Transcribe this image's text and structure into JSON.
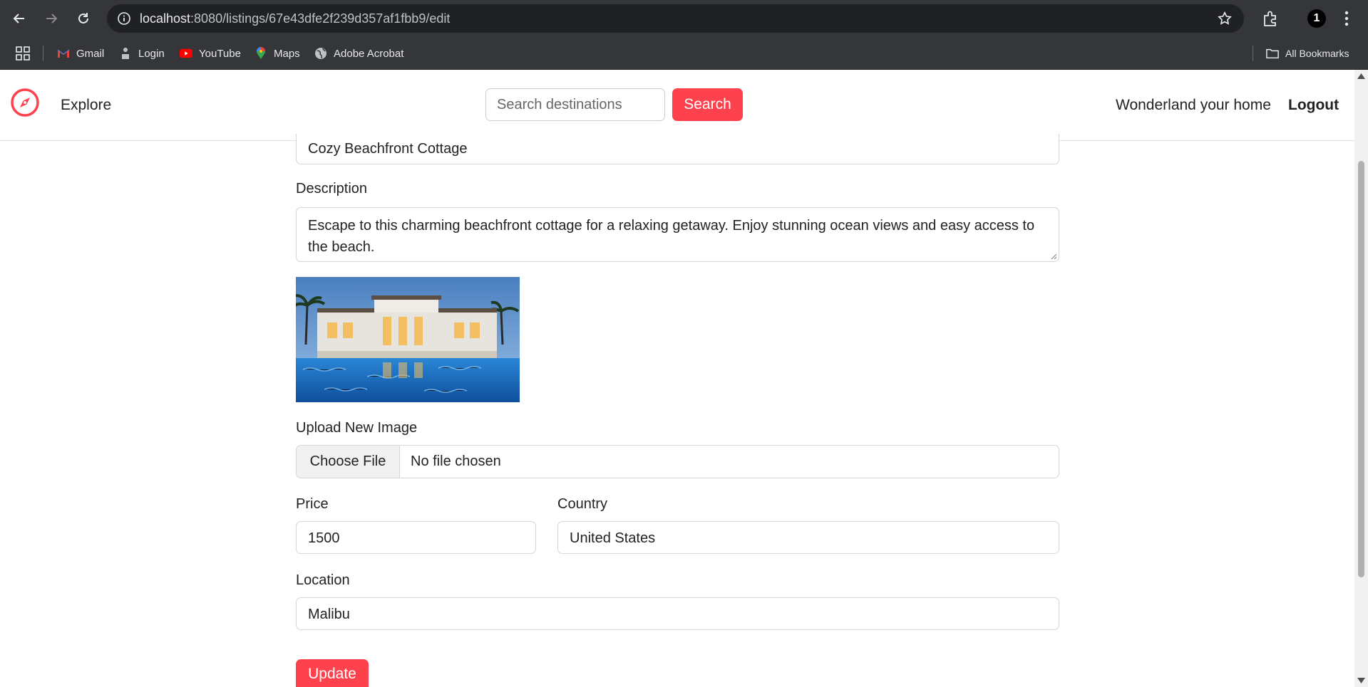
{
  "browser": {
    "url_host": "localhost",
    "url_path": ":8080/listings/67e43dfe2f239d357af1fbb9/edit",
    "profile_initial": "1",
    "bookmarks": [
      {
        "label": "Gmail",
        "icon": "gmail-icon"
      },
      {
        "label": "Login",
        "icon": "login-icon"
      },
      {
        "label": "YouTube",
        "icon": "youtube-icon"
      },
      {
        "label": "Maps",
        "icon": "maps-icon"
      },
      {
        "label": "Adobe Acrobat",
        "icon": "globe-icon"
      }
    ],
    "all_bookmarks": "All Bookmarks"
  },
  "navbar": {
    "brand_icon": "compass-icon",
    "explore": "Explore",
    "search_placeholder": "Search destinations",
    "search_button": "Search",
    "host_link": "Wonderland your home",
    "logout": "Logout"
  },
  "form": {
    "title_value": "Cozy Beachfront Cottage",
    "description_label": "Description",
    "description_value": "Escape to this charming beachfront cottage for a relaxing getaway. Enjoy stunning ocean views and easy access to the beach.",
    "upload_label": "Upload New Image",
    "choose_file": "Choose File",
    "no_file": "No file chosen",
    "price_label": "Price",
    "price_value": "1500",
    "country_label": "Country",
    "country_value": "United States",
    "location_label": "Location",
    "location_value": "Malibu",
    "update_button": "Update"
  },
  "colors": {
    "accent": "#fe424d",
    "chrome_bg": "#35363a",
    "omnibox_bg": "#202124"
  }
}
